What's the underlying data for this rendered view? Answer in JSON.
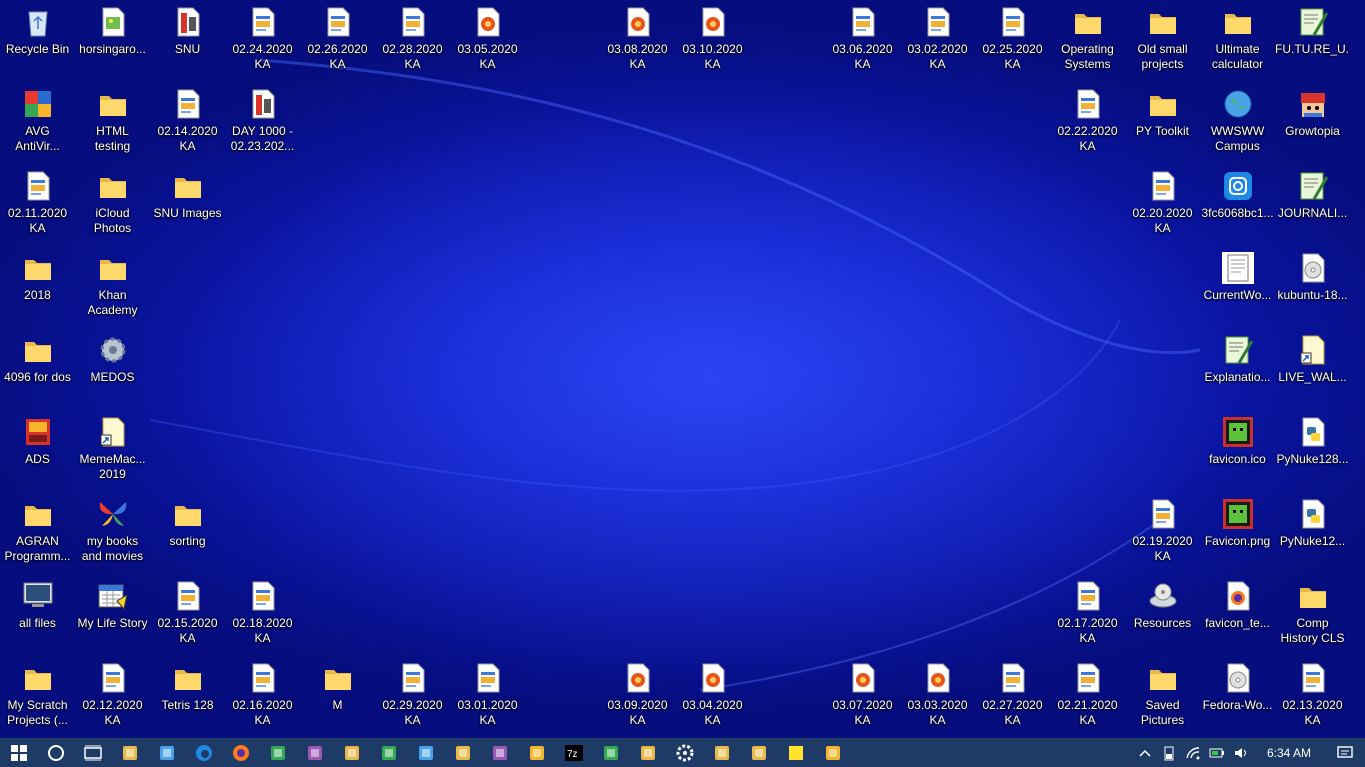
{
  "desktop": {
    "icons": [
      {
        "label": "Recycle Bin",
        "icon": "recycle-bin-icon"
      },
      {
        "label": "horsingaro...",
        "icon": "image-file-icon"
      },
      {
        "label": "SNU",
        "icon": "document-file-icon"
      },
      {
        "label": "02.24.2020\nKA",
        "icon": "web-page-file-icon"
      },
      {
        "label": "02.26.2020\nKA",
        "icon": "web-page-file-icon"
      },
      {
        "label": "02.28.2020\nKA",
        "icon": "web-page-file-icon"
      },
      {
        "label": "03.05.2020\nKA",
        "icon": "orange-web-file-icon"
      },
      {
        "label": "03.08.2020\nKA",
        "icon": "orange-web-file-icon"
      },
      {
        "label": "03.10.2020\nKA",
        "icon": "orange-web-file-icon"
      },
      {
        "label": "03.06.2020\nKA",
        "icon": "web-page-file-icon"
      },
      {
        "label": "03.02.2020\nKA",
        "icon": "web-page-file-icon"
      },
      {
        "label": "02.25.2020\nKA",
        "icon": "web-page-file-icon"
      },
      {
        "label": "Operating\nSystems",
        "icon": "folder-icon"
      },
      {
        "label": "Old small\nprojects",
        "icon": "folder-icon"
      },
      {
        "label": "Ultimate\ncalculator",
        "icon": "folder-icon"
      },
      {
        "label": "FU.TU.RE_U...",
        "icon": "notepad-plus-icon"
      },
      {
        "label": "AVG\nAntiVir...",
        "icon": "avg-antivirus-icon"
      },
      {
        "label": "HTML\ntesting",
        "icon": "folder-icon"
      },
      {
        "label": "02.14.2020\nKA",
        "icon": "web-page-file-icon"
      },
      {
        "label": "DAY 1000 -\n02.23.202...",
        "icon": "document-file-icon"
      },
      {
        "label": "02.22.2020\nKA",
        "icon": "web-page-file-icon"
      },
      {
        "label": "PY Toolkit",
        "icon": "folder-icon"
      },
      {
        "label": "WWSWW\nCampus",
        "icon": "globe-icon"
      },
      {
        "label": "Growtopia",
        "icon": "growtopia-icon"
      },
      {
        "label": "02.11.2020\nKA",
        "icon": "web-page-file-icon"
      },
      {
        "label": "iCloud\nPhotos",
        "icon": "folder-icon"
      },
      {
        "label": "SNU Images",
        "icon": "folder-icon"
      },
      {
        "label": "02.20.2020\nKA",
        "icon": "web-page-file-icon"
      },
      {
        "label": "3fc6068bc1...",
        "icon": "instagram-icon"
      },
      {
        "label": "JOURNALI...",
        "icon": "notepad-plus-icon"
      },
      {
        "label": "2018",
        "icon": "folder-icon"
      },
      {
        "label": "Khan\nAcademy",
        "icon": "folder-icon"
      },
      {
        "label": "CurrentWo...",
        "icon": "text-document-icon"
      },
      {
        "label": "kubuntu-18...",
        "icon": "disc-image-icon"
      },
      {
        "label": "4096 for dos",
        "icon": "folder-icon"
      },
      {
        "label": "MEDOS",
        "icon": "gear-cluster-icon"
      },
      {
        "label": "Explanatio...",
        "icon": "notepad-plus-icon"
      },
      {
        "label": "LIVE_WAL...",
        "icon": "shortcut-file-icon"
      },
      {
        "label": "ADS",
        "icon": "ads-app-icon"
      },
      {
        "label": "MemeMac...\n2019",
        "icon": "shortcut-file-icon"
      },
      {
        "label": "favicon.ico",
        "icon": "favicon-icon"
      },
      {
        "label": "PyNuke128...",
        "icon": "python-file-icon"
      },
      {
        "label": "AGRAN\nProgramm...",
        "icon": "folder-icon"
      },
      {
        "label": "my books\nand movies",
        "icon": "butterfly-icon"
      },
      {
        "label": "sorting",
        "icon": "folder-icon"
      },
      {
        "label": "02.19.2020\nKA",
        "icon": "web-page-file-icon"
      },
      {
        "label": "Favicon.png",
        "icon": "favicon-icon"
      },
      {
        "label": "PyNuke12...",
        "icon": "python-file-icon"
      },
      {
        "label": "all files",
        "icon": "computer-monitor-icon"
      },
      {
        "label": "My Life Story",
        "icon": "calendar-app-icon"
      },
      {
        "label": "02.15.2020\nKA",
        "icon": "web-page-file-icon"
      },
      {
        "label": "02.18.2020\nKA",
        "icon": "web-page-file-icon"
      },
      {
        "label": "02.17.2020\nKA",
        "icon": "web-page-file-icon"
      },
      {
        "label": "Resources",
        "icon": "drive-icon"
      },
      {
        "label": "favicon_te...",
        "icon": "firefox-file-icon"
      },
      {
        "label": "Comp\nHistory CLS",
        "icon": "folder-icon"
      },
      {
        "label": "My Scratch\nProjects (...",
        "icon": "folder-icon"
      },
      {
        "label": "02.12.2020\nKA",
        "icon": "web-page-file-icon"
      },
      {
        "label": "Tetris 128",
        "icon": "folder-icon"
      },
      {
        "label": "02.16.2020\nKA",
        "icon": "web-page-file-icon"
      },
      {
        "label": "M",
        "icon": "folder-icon"
      },
      {
        "label": "02.29.2020\nKA",
        "icon": "web-page-file-icon"
      },
      {
        "label": "03.01.2020\nKA",
        "icon": "web-page-file-icon"
      },
      {
        "label": "03.09.2020\nKA",
        "icon": "orange-web-file-icon"
      },
      {
        "label": "03.04.2020\nKA",
        "icon": "orange-web-file-icon"
      },
      {
        "label": "03.07.2020\nKA",
        "icon": "orange-web-file-icon"
      },
      {
        "label": "03.03.2020\nKA",
        "icon": "orange-web-file-icon"
      },
      {
        "label": "02.27.2020\nKA",
        "icon": "web-page-file-icon"
      },
      {
        "label": "02.21.2020\nKA",
        "icon": "web-page-file-icon"
      },
      {
        "label": "Saved\nPictures",
        "icon": "folder-icon"
      },
      {
        "label": "Fedora-Wo...",
        "icon": "disc-image-icon"
      },
      {
        "label": "02.13.2020\nKA",
        "icon": "web-page-file-icon"
      }
    ]
  },
  "taskbar": {
    "buttons": [
      "start-button",
      "cortana-search-button",
      "task-view-button",
      "computer-icon",
      "books-app-icon",
      "edge-icon",
      "firefox-icon",
      "file-icon",
      "pet-app-icon",
      "game-app-icon",
      "gimp-icon",
      "green-app-icon",
      "explorer-icon",
      "notepad-icon",
      "orange-app-icon",
      "7zip-icon",
      "picture-app-icon",
      "cube-app-icon",
      "settings-icon",
      "blue-app-icon",
      "film-app-icon",
      "sticky-notes-icon",
      "photos-app-icon"
    ],
    "tray": {
      "icons": [
        "chevron-up-icon",
        "battery-icon",
        "wifi-icon",
        "power-icon",
        "volume-icon"
      ],
      "time": "6:34 AM",
      "notification_icon": "notification-icon"
    }
  }
}
